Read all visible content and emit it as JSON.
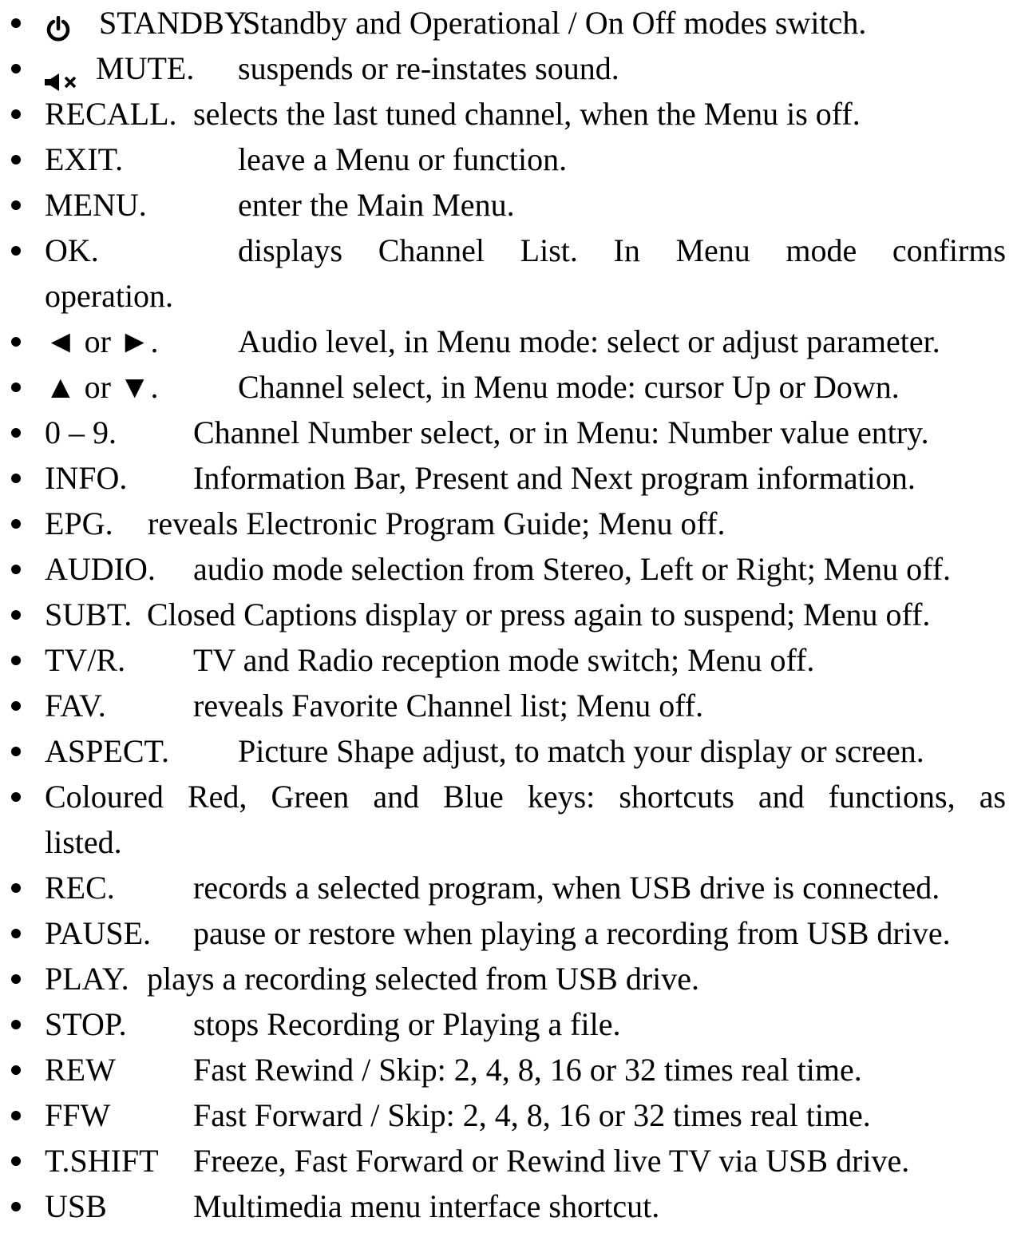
{
  "items": [
    {
      "key": "STANDBY.",
      "desc": "Standby and Operational / On Off modes switch.",
      "icon": "power-icon"
    },
    {
      "key": "MUTE.",
      "desc": "suspends or re-instates sound.",
      "icon": "mute-speaker-icon"
    },
    {
      "key": "RECALL.",
      "desc": "selects the last tuned channel, when the Menu is off."
    },
    {
      "key": "EXIT.",
      "desc": "leave a Menu or function."
    },
    {
      "key": "MENU.",
      "desc": "enter the Main Menu."
    },
    {
      "key": "OK.",
      "desc_words": [
        "displays",
        "Channel",
        "List.",
        "In",
        "Menu",
        "mode",
        "confirms"
      ],
      "desc_cont": "operation."
    },
    {
      "key": "◄ or ►.",
      "desc": "Audio level, in Menu mode: select or adjust parameter."
    },
    {
      "key": "▲ or ▼.",
      "desc": "Channel select, in Menu mode: cursor Up or Down."
    },
    {
      "key": "0 – 9.",
      "desc": "Channel Number select, or in Menu: Number value entry."
    },
    {
      "key": "INFO.",
      "desc": "Information Bar, Present and Next program information."
    },
    {
      "key": "EPG.",
      "desc": "reveals Electronic Program Guide; Menu off."
    },
    {
      "key": "AUDIO.",
      "desc": "audio mode selection from Stereo, Left or Right; Menu off."
    },
    {
      "key": "SUBT.",
      "desc": "Closed Captions display or press again to suspend; Menu off."
    },
    {
      "key": "TV/R.",
      "desc": "TV and Radio reception mode switch; Menu off."
    },
    {
      "key": "FAV.",
      "desc": "reveals Favorite Channel list; Menu off."
    },
    {
      "key": "ASPECT.",
      "desc": "Picture Shape adjust, to match your display or screen."
    },
    {
      "text_words": [
        "Coloured",
        "Red,",
        "Green",
        "and",
        "Blue",
        "keys:",
        "shortcuts",
        "and",
        "functions,",
        "as"
      ],
      "desc_cont": "listed."
    },
    {
      "key": "REC.",
      "desc": "records a selected program, when USB drive is connected."
    },
    {
      "key": "PAUSE.",
      "desc": "pause or restore when playing a recording from USB drive."
    },
    {
      "key": "PLAY.",
      "desc": "plays a recording selected from USB drive."
    },
    {
      "key": "STOP.",
      "desc": "stops Recording or Playing a file."
    },
    {
      "key": "REW",
      "desc": "Fast Rewind / Skip: 2, 4, 8, 16 or 32 times real time."
    },
    {
      "key": "FFW",
      "desc": "Fast Forward / Skip: 2, 4, 8, 16 or 32 times real time."
    },
    {
      "key": "T.SHIFT",
      "desc": "Freeze, Fast Forward or Rewind live TV via USB drive."
    },
    {
      "key": "USB",
      "desc": "Multimedia menu interface shortcut."
    }
  ]
}
